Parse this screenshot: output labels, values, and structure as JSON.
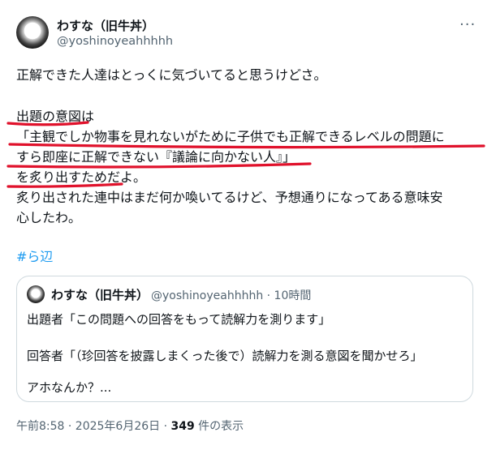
{
  "author": {
    "display_name": "わすな（旧牛丼）",
    "handle": "@yoshinoyeahhhhh"
  },
  "more_icon": "more-horizontal-icon",
  "tweet": {
    "lines": [
      "正解できた人達はとっくに気づいてると思うけどさ。",
      "出題の意図は",
      "「主観でしか物事を見れないがために子供でも正解できるレベルの問題に",
      "すら即座に正解できない『議論に向かない人』」",
      "を炙り出すためだよ。",
      "炙り出された連中はまだ何か喚いてるけど、予想通りになってある意味安",
      "心したわ。"
    ],
    "hashtag": "#ら辺"
  },
  "annotation_color": "#e0112b",
  "quote": {
    "display_name": "わすな（旧牛丼）",
    "meta": "@yoshinoyeahhhhh · 10時間",
    "lines": [
      "出題者「この問題への回答をもって読解力を測ります」",
      "回答者「（珍回答を披露しまくった後で）読解力を測る意図を聞かせろ」",
      "アホなんか？..."
    ]
  },
  "footer": {
    "time": "午前8:58 · 2025年6月26日 · ",
    "views_count": "349",
    "views_label": " 件の表示"
  }
}
